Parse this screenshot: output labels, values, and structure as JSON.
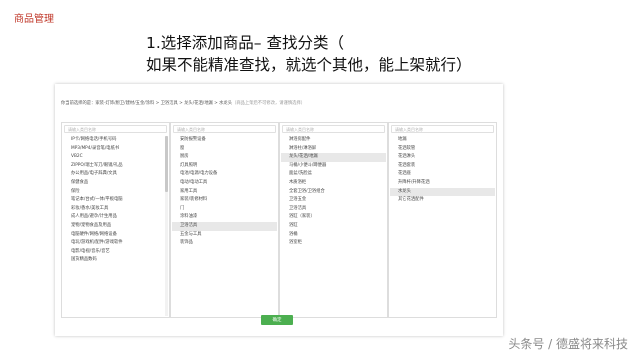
{
  "page_tag": "商品管理",
  "heading": {
    "line1": "1.选择添加商品– 查找分类（",
    "line2": "如果不能精准查找，就选个其他，能上架就行）"
  },
  "breadcrumb": {
    "prefix": "你当前选择的是：",
    "path": "家装-灯饰/厨卫/建材/五金/涂料 > 卫浴洁具 > 龙头/花洒/地漏 > 水龙头",
    "hint": "（商品上架后不可修改，请谨慎选择）"
  },
  "columns": [
    {
      "placeholder": "请输入类目名称",
      "items": [
        "IP卡/网络电话/手机号码",
        "MP3/MP4/录音笔/电纸书",
        "VB2C",
        "ZIPPO/瑞士军刀/眼镜/礼品",
        "办公用品/电子辞典/文具",
        "保健食品",
        "保险",
        "笔记本/台式/一体/平板电脑",
        "彩妆/香水/美妆工具",
        "成人用品/避孕/计生用品",
        "宠物/宠物食品及用品",
        "电脑硬件/网络/网络设备",
        "电玩/游戏机/配件/游戏软件",
        "电影/电视/音乐/音艺",
        "国货精品数码"
      ],
      "active": -1
    },
    {
      "placeholder": "请输入类目名称",
      "items": [
        "安防报警设备",
        "窗",
        "厨房",
        "灯具照明",
        "电池/电源/电力设备",
        "电动/电动工具",
        "家用工具",
        "家装/装修材料",
        "门",
        "涂料油漆",
        "卫浴洁具",
        "五金与工具",
        "装饰品"
      ],
      "active": 10
    },
    {
      "placeholder": "请输入类目名称",
      "items": [
        "淋浴房配件",
        "淋浴柱/淋浴屏",
        "龙头/花洒/地漏",
        "马桶/小便斗/蹲便器",
        "面盆/洗脸盆",
        "木质浴柜",
        "全套卫浴/卫浴组合",
        "卫浴五金",
        "卫浴洁具",
        "浴缸（家装）",
        "浴缸",
        "浴桶",
        "浴室柜"
      ],
      "active": 2
    },
    {
      "placeholder": "请输入类目名称",
      "items": [
        "地漏",
        "花洒软管",
        "花洒淋头",
        "花洒套装",
        "花洒座",
        "升降杆/升降花洒",
        "水龙头",
        "其它花洒配件"
      ],
      "active": 6
    }
  ],
  "confirm_label": "确定",
  "watermark": "头条号 / 德盛将来科技"
}
